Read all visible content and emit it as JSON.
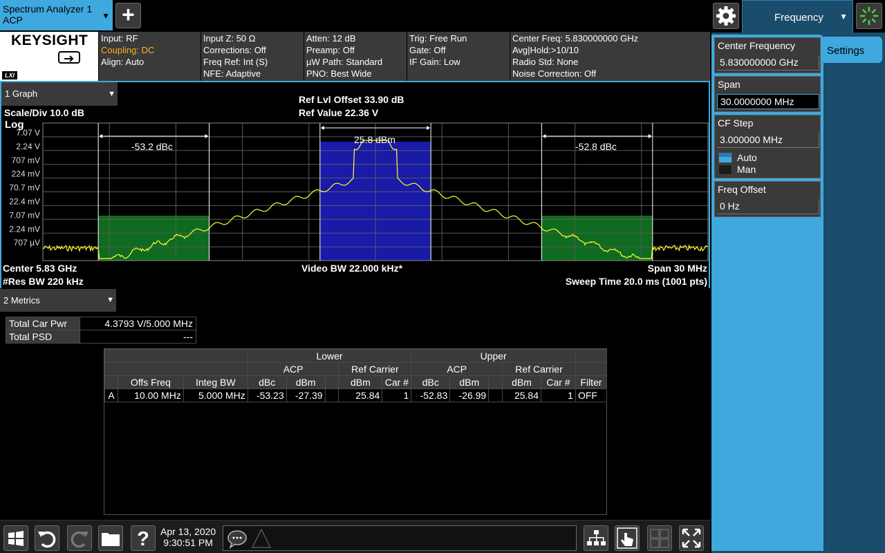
{
  "tabs": {
    "analyzer": {
      "line1": "Spectrum Analyzer 1",
      "line2": "ACP"
    }
  },
  "top_menu": {
    "label": "Frequency"
  },
  "brand": {
    "logo": "KEYSIGHT",
    "lxi": "LXI"
  },
  "settings": {
    "g1": [
      "Input: RF",
      "Coupling: DC",
      "Align: Auto"
    ],
    "g2": [
      "Input Z: 50 Ω",
      "Corrections: Off",
      "Freq Ref: Int (S)",
      "NFE: Adaptive"
    ],
    "g3": [
      "Atten: 12 dB",
      "Preamp: Off",
      "µW Path: Standard",
      "PNO: Best Wide"
    ],
    "g4": [
      "Trig: Free Run",
      "Gate: Off",
      "IF Gain: Low"
    ],
    "g5": [
      "Center Freq: 5.830000000 GHz",
      "Avg|Hold:>10/10",
      "Radio Std: None",
      "Noise Correction: Off"
    ]
  },
  "graph": {
    "selector": "1 Graph",
    "ref_offset": "Ref Lvl Offset 33.90 dB",
    "ref_value": "Ref Value 22.36 V",
    "scale": "Scale/Div 10.0 dB",
    "scale_type": "Log",
    "y_ticks": [
      "7.07 V",
      "2.24 V",
      "707 mV",
      "224 mV",
      "70.7 mV",
      "22.4 mV",
      "7.07 mV",
      "2.24 mV",
      "707 µV"
    ],
    "center": "Center 5.83 GHz",
    "video_bw": "Video BW 22.000 kHz*",
    "span": "Span 30 MHz",
    "res_bw": "#Res BW 220 kHz",
    "sweep": "Sweep Time 20.0 ms",
    "pts": "(1001 pts)",
    "annot_lower": "-53.2 dBc",
    "annot_carrier": "25.8 dBm",
    "annot_upper": "-52.8 dBc",
    "colors": {
      "carrier_fill": "#1a1aa8",
      "adjacent_fill": "#0f6b1f",
      "trace": "#ffff33",
      "grid": "#5a5a5a"
    }
  },
  "metrics": {
    "selector": "2 Metrics",
    "total_car_pwr_label": "Total Car Pwr",
    "total_car_pwr_value": "4.3793 V/5.000 MHz",
    "total_psd_label": "Total PSD",
    "total_psd_value": "---"
  },
  "acp": {
    "group_lower": "Lower",
    "group_upper": "Upper",
    "sub_acp": "ACP",
    "sub_ref": "Ref Carrier",
    "cols": [
      "Offs Freq",
      "Integ BW",
      "dBc",
      "dBm",
      "dBm",
      "Car #",
      "dBc",
      "dBm",
      "dBm",
      "Car #",
      "Filter"
    ],
    "row": {
      "id": "A",
      "offs": "10.00 MHz",
      "integ": "5.000 MHz",
      "l_dbc": "-53.23",
      "l_dbm": "-27.39",
      "l_ref_dbm": "25.84",
      "l_car": "1",
      "u_dbc": "-52.83",
      "u_dbm": "-26.99",
      "u_ref_dbm": "25.84",
      "u_car": "1",
      "filter": "OFF"
    }
  },
  "panel": {
    "tab": "Settings",
    "center_freq_label": "Center Frequency",
    "center_freq_value": "5.830000000 GHz",
    "span_label": "Span",
    "span_value": "30.0000000 MHz",
    "cf_step_label": "CF Step",
    "cf_step_value": "3.000000 MHz",
    "auto_label": "Auto",
    "man_label": "Man",
    "freq_offset_label": "Freq Offset",
    "freq_offset_value": "0 Hz"
  },
  "taskbar": {
    "date": "Apr 13, 2020",
    "time": "9:30:51 PM"
  }
}
